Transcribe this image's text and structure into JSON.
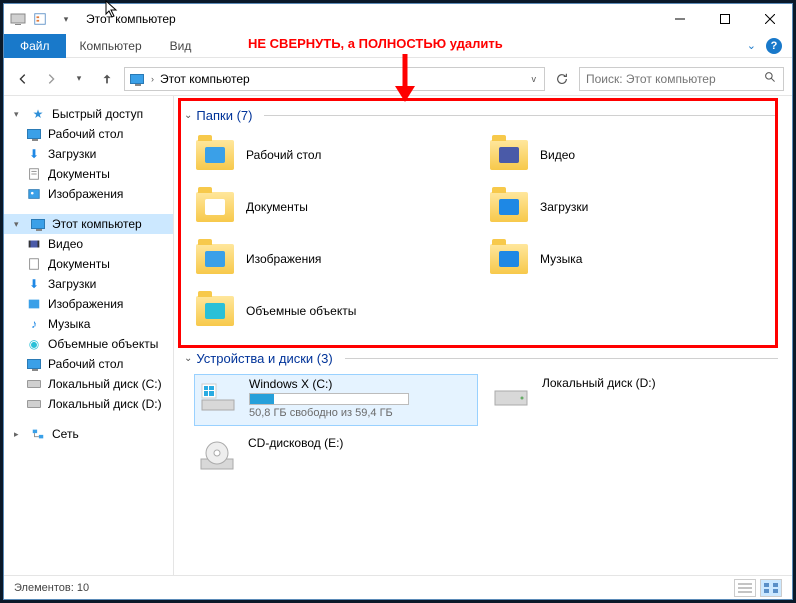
{
  "title": "Этот компьютер",
  "annotation": "НЕ СВЕРНУТЬ, а ПОЛНОСТЬЮ удалить",
  "ribbon": {
    "file": "Файл",
    "computer": "Компьютер",
    "view": "Вид"
  },
  "address": {
    "path": "Этот компьютер"
  },
  "search": {
    "placeholder": "Поиск: Этот компьютер"
  },
  "nav": {
    "quick": "Быстрый доступ",
    "quick_items": [
      "Рабочий стол",
      "Загрузки",
      "Документы",
      "Изображения"
    ],
    "this_pc": "Этот компьютер",
    "pc_items": [
      "Видео",
      "Документы",
      "Загрузки",
      "Изображения",
      "Музыка",
      "Объемные объекты",
      "Рабочий стол",
      "Локальный диск (C:)",
      "Локальный диск (D:)"
    ],
    "network": "Сеть"
  },
  "sections": {
    "folders_title": "Папки (7)",
    "drives_title": "Устройства и диски (3)"
  },
  "folders": [
    {
      "name": "Рабочий стол",
      "overlay": "#3aa0e8"
    },
    {
      "name": "Видео",
      "overlay": "#4a5aa8"
    },
    {
      "name": "Документы",
      "overlay": "#ffffff"
    },
    {
      "name": "Загрузки",
      "overlay": "#1e88e5"
    },
    {
      "name": "Изображения",
      "overlay": "#3aa0e8"
    },
    {
      "name": "Музыка",
      "overlay": "#1e88e5"
    },
    {
      "name": "Объемные объекты",
      "overlay": "#2ac0d8"
    }
  ],
  "drives": [
    {
      "name": "Windows X (C:)",
      "sub": "50,8 ГБ свободно из 59,4 ГБ",
      "fill": 15,
      "type": "os",
      "selected": true
    },
    {
      "name": "Локальный диск (D:)",
      "sub": "",
      "fill": 0,
      "type": "hdd",
      "selected": false
    },
    {
      "name": "CD-дисковод (E:)",
      "sub": "",
      "fill": 0,
      "type": "cd",
      "selected": false
    }
  ],
  "status": {
    "count_label": "Элементов:",
    "count": "10"
  }
}
